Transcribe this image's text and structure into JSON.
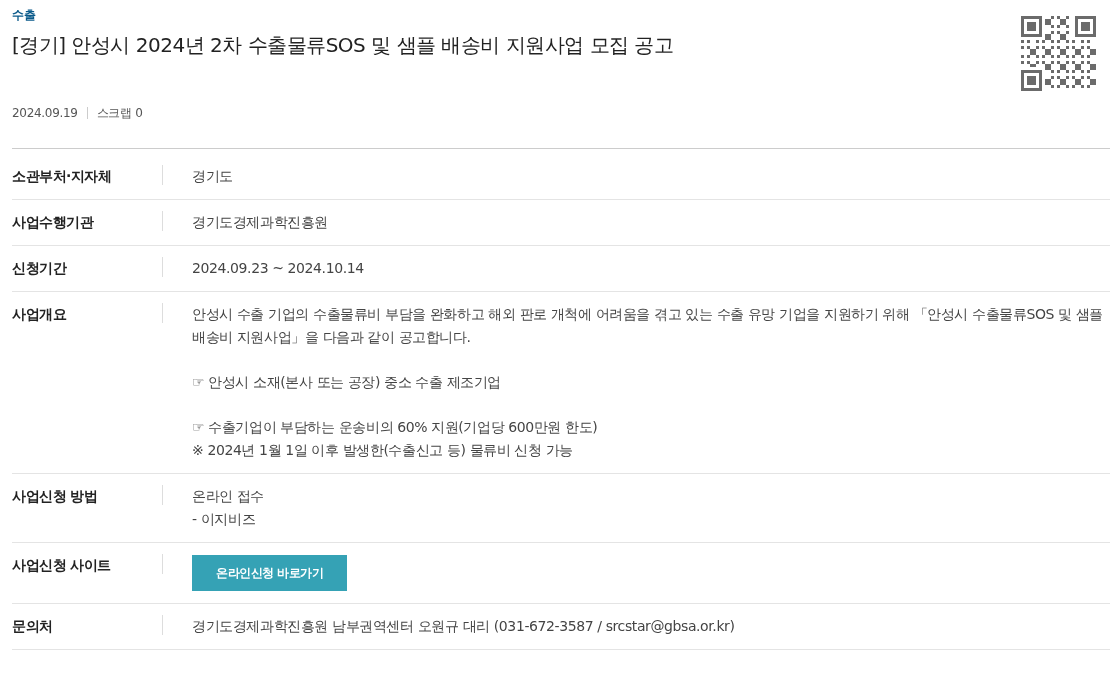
{
  "category": "수출",
  "title": "[경기] 안성시 2024년 2차 수출물류SOS 및 샘플 배송비 지원사업 모집 공고",
  "meta": {
    "date": "2024.09.19",
    "scrap": "스크랩 0"
  },
  "rows": [
    {
      "label": "소관부처·지자체",
      "kind": "text",
      "paragraphs": [
        [
          "경기도"
        ]
      ]
    },
    {
      "label": "사업수행기관",
      "kind": "text",
      "paragraphs": [
        [
          "경기도경제과학진흥원"
        ]
      ]
    },
    {
      "label": "신청기간",
      "kind": "text",
      "paragraphs": [
        [
          "2024.09.23 ~ 2024.10.14"
        ]
      ]
    },
    {
      "label": "사업개요",
      "kind": "text",
      "paragraphs": [
        [
          "안성시 수출 기업의 수출물류비 부담을 완화하고 해외 판로 개척에 어려움을 겪고 있는 수출 유망 기업을 지원하기 위해 「안성시 수출물류SOS 및 샘플 배송비 지원사업」을 다음과 같이 공고합니다."
        ],
        [
          "☞ 안성시 소재(본사 또는 공장) 중소 수출 제조기업"
        ],
        [
          "☞ 수출기업이 부담하는 운송비의 60% 지원(기업당 600만원 한도)",
          "※ 2024년 1월 1일 이후 발생한(수출신고 등) 물류비 신청 가능"
        ]
      ]
    },
    {
      "label": "사업신청 방법",
      "kind": "text",
      "paragraphs": [
        [
          "온라인 접수",
          "- 이지비즈"
        ]
      ]
    },
    {
      "label": "사업신청 사이트",
      "kind": "button",
      "button": "온라인신청 바로가기"
    },
    {
      "label": "문의처",
      "kind": "text",
      "paragraphs": [
        [
          "경기도경제과학진흥원 남부권역센터 오원규 대리 (031-672-3587 / srcstar@gbsa.or.kr)"
        ]
      ]
    }
  ]
}
